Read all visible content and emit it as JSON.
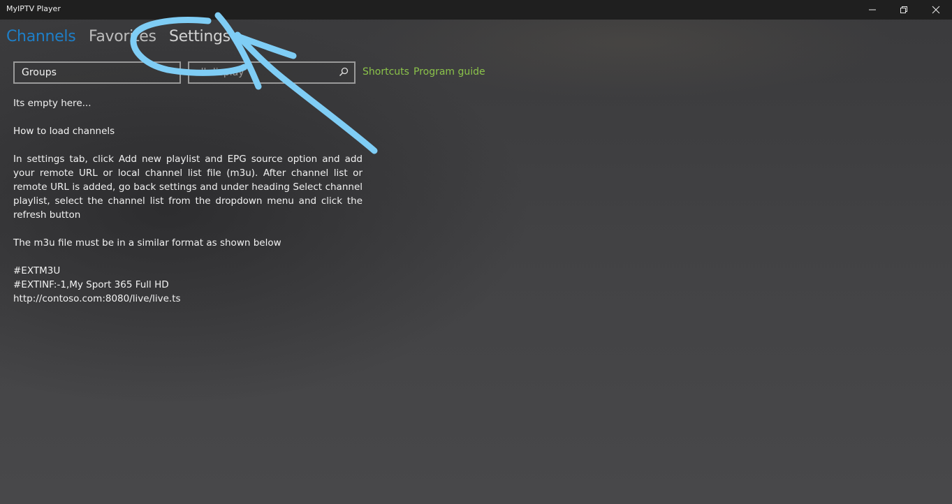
{
  "window": {
    "title": "MyIPTV Player"
  },
  "tabs": [
    {
      "label": "Channels",
      "active": true
    },
    {
      "label": "Favorites",
      "active": false
    },
    {
      "label": "Settings",
      "active": false
    }
  ],
  "toolbar": {
    "groups_value": "Groups",
    "search_placeholder": "all display",
    "shortcuts_label": "Shortcuts",
    "program_guide_label": "Program guide"
  },
  "empty_state": {
    "heading": "Its empty here...",
    "howto_title": "How to load  channels",
    "instructions": "In settings tab, click Add new playlist and EPG source  option and add your remote URL or local channel list file (m3u). After channel list or remote URL is added, go back settings and under heading  Select channel playlist, select the channel list from the dropdown menu and click the refresh button",
    "format_note": "The m3u file must be in a similar format as shown below",
    "example_lines": [
      "#EXTM3U",
      "#EXTINF:-1,My Sport 365 Full HD",
      "http://contoso.com:8080/live/live.ts"
    ]
  },
  "colors": {
    "accent_active_tab": "#1e7fc8",
    "link_green": "#8bc34a",
    "annotation_blue": "#7fcdf5",
    "titlebar": "#1f1f1f"
  },
  "icons": {
    "search": "search-icon",
    "minimize": "minimize-icon",
    "maximize": "restore-icon",
    "close": "close-icon"
  }
}
